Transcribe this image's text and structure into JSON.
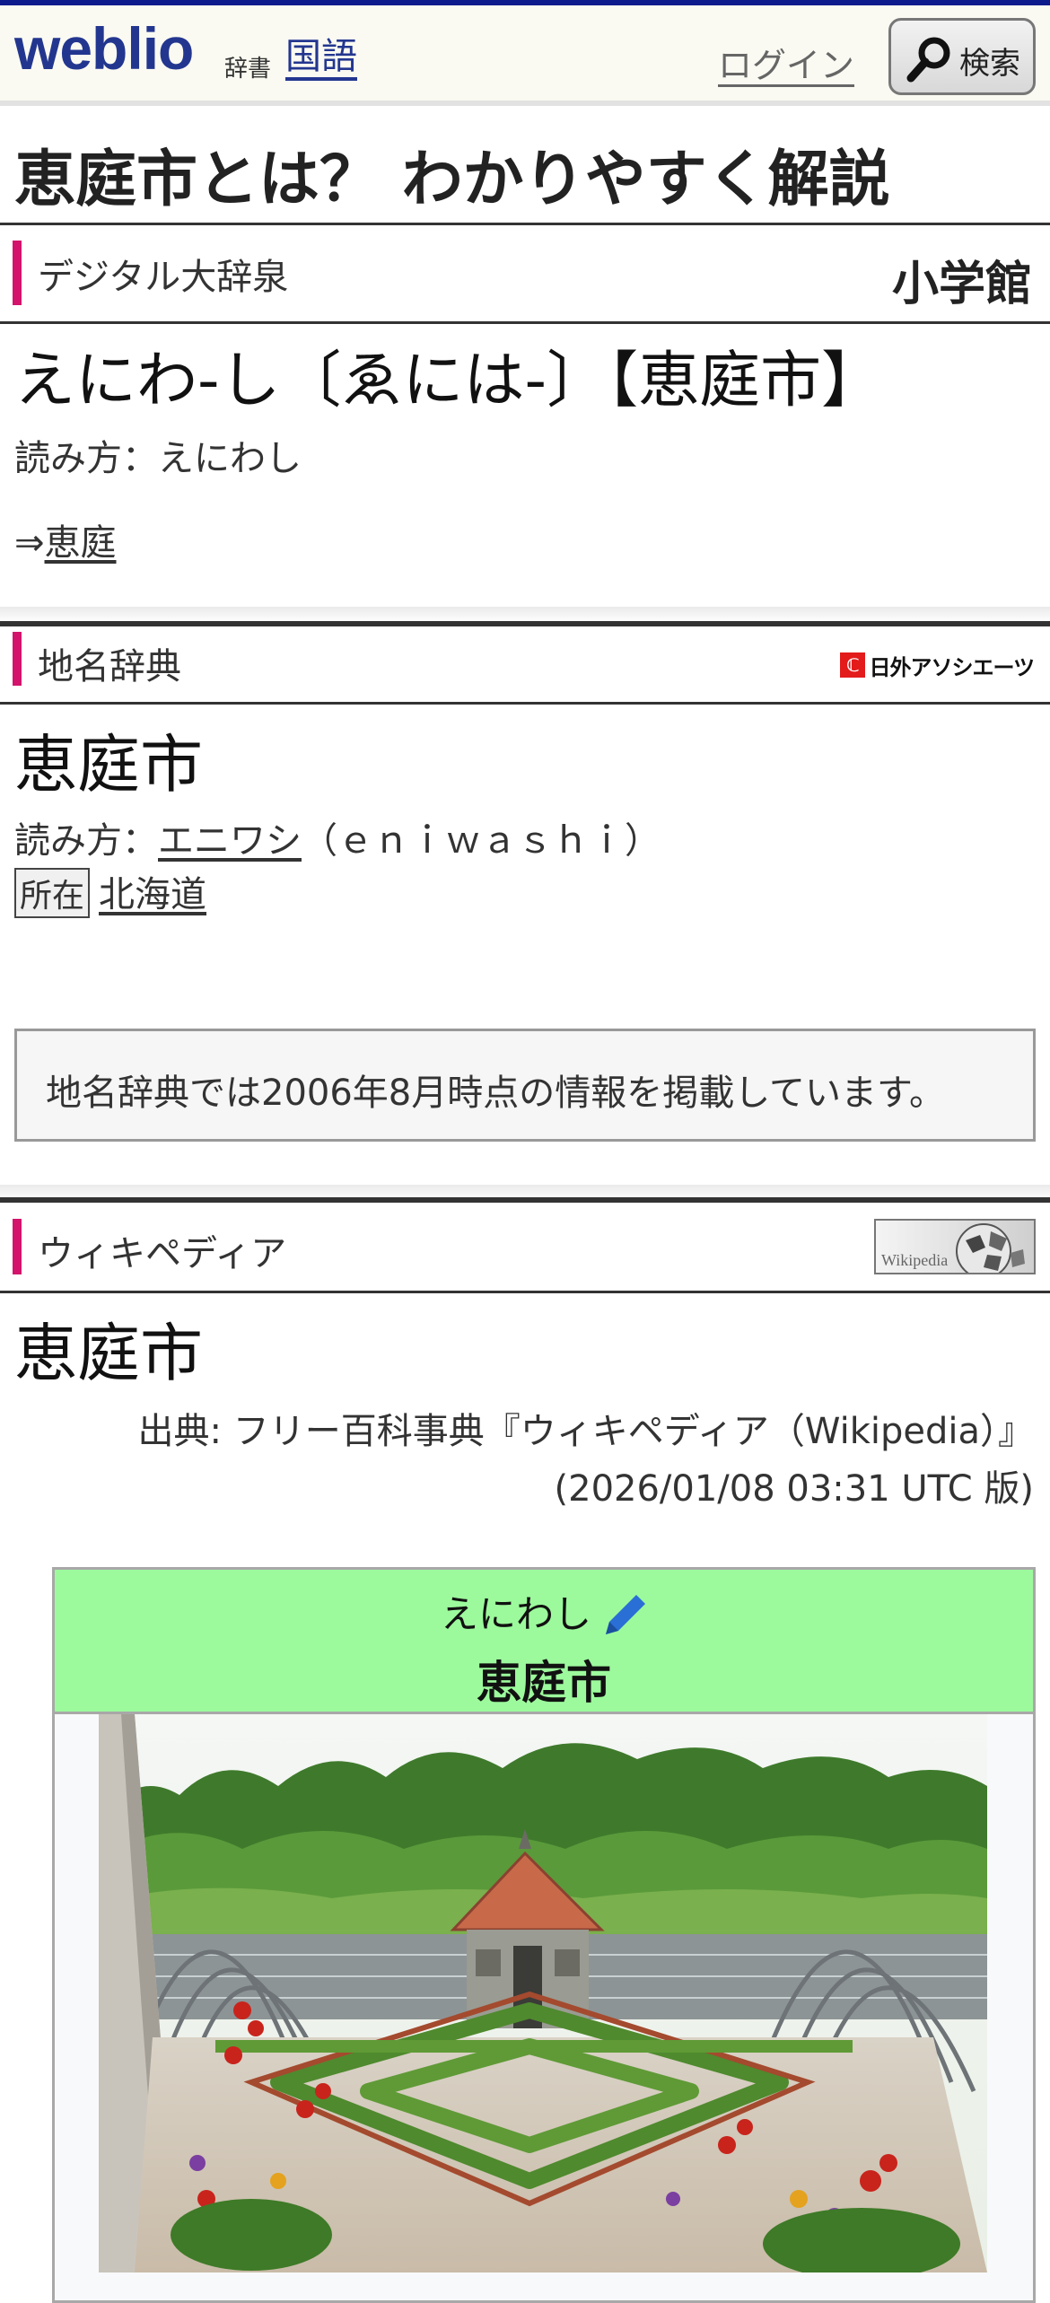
{
  "header": {
    "logo": "weblio",
    "logo_sub": "辞書",
    "nav_kokugo": "国語",
    "login": "ログイン",
    "search_label": "検索"
  },
  "page": {
    "title": "恵庭市とは？ わかりやすく解説"
  },
  "sections": {
    "daijisen": {
      "name": "デジタル大辞泉",
      "publisher": "小学館",
      "headword": "えにわ‐し〔ゑには‐〕【恵庭市】",
      "reading": "読み方：えにわし",
      "arrow": "⇒",
      "link": "恵庭"
    },
    "chimei": {
      "name": "地名辞典",
      "publisher_mark": "ℂ",
      "publisher": "日外アソシエーツ",
      "headword": "恵庭市",
      "reading_label": "読み方：",
      "reading_link": "エニワシ",
      "reading_roman": "（ｅｎｉｗａｓｈｉ）",
      "location_tag": "所在",
      "location_link": "北海道",
      "notice": "地名辞典では2006年8月時点の情報を掲載しています。"
    },
    "wikipedia": {
      "name": "ウィキペディア",
      "logo_text": "Wikipedia",
      "headword": "恵庭市",
      "source_line1": "出典: フリー百科事典『ウィキペディア（Wikipedia）』",
      "source_line2": "(2026/01/08 03:31 UTC 版)",
      "infobox_kana": "えにわし",
      "infobox_name": "恵庭市"
    }
  },
  "colors": {
    "brand_blue": "#23368f",
    "section_accent": "#d3136c",
    "infobox_header": "#9cfa9c"
  }
}
